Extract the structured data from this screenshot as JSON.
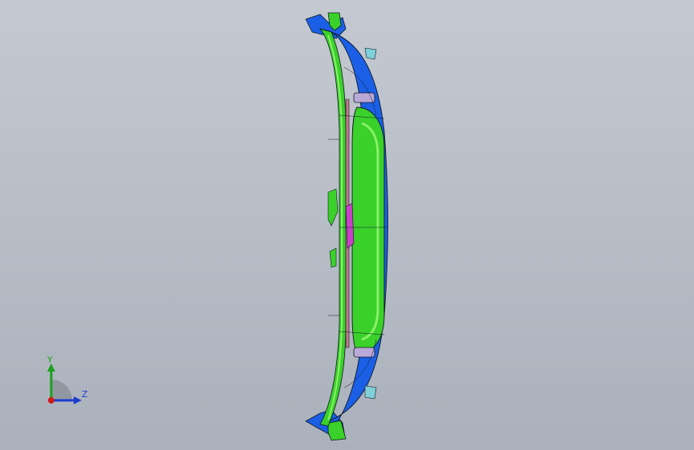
{
  "viewport": {
    "background_top": "#c4c9d1",
    "background_bottom": "#abb1bc"
  },
  "model": {
    "colors": {
      "primary_face": "#1a5fe6",
      "flange_face": "#3ad12a",
      "highlight_face": "#8bf06a",
      "accent_face": "#c840c8",
      "clip_face": "#b9a8d8",
      "edge_lines": "#101820"
    }
  },
  "triad": {
    "y_label": "Y",
    "z_label": "Z",
    "y_color": "#1aa01a",
    "z_color": "#1d3fd0",
    "origin_color": "#d01a1a"
  }
}
